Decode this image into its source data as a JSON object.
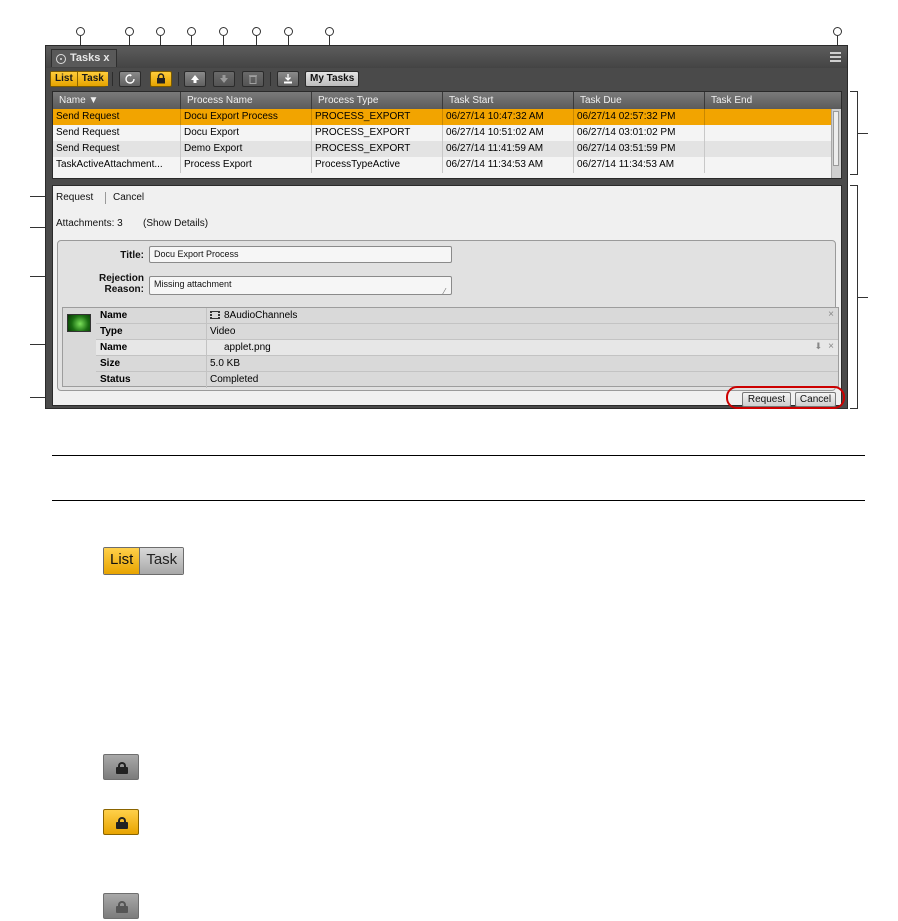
{
  "window": {
    "tab_label": "Tasks x"
  },
  "toolbar": {
    "list_label": "List",
    "task_label": "Task",
    "my_tasks_label": "My Tasks"
  },
  "table": {
    "columns": [
      "Name ▼",
      "Process Name",
      "Process Type",
      "Task Start",
      "Task Due",
      "Task End"
    ],
    "rows": [
      {
        "name": "Send Request",
        "process_name": "Docu Export Process",
        "process_type": "PROCESS_EXPORT",
        "task_start": "06/27/14 10:47:32 AM",
        "task_due": "06/27/14 02:57:32 PM",
        "task_end": ""
      },
      {
        "name": "Send Request",
        "process_name": "Docu Export",
        "process_type": "PROCESS_EXPORT",
        "task_start": "06/27/14 10:51:02 AM",
        "task_due": "06/27/14 03:01:02 PM",
        "task_end": ""
      },
      {
        "name": "Send Request",
        "process_name": "Demo Export",
        "process_type": "PROCESS_EXPORT",
        "task_start": "06/27/14 11:41:59 AM",
        "task_due": "06/27/14 03:51:59 PM",
        "task_end": ""
      },
      {
        "name": "TaskActiveAttachment...",
        "process_name": "Process Export",
        "process_type": "ProcessTypeActive",
        "task_start": "06/27/14 11:34:53 AM",
        "task_due": "06/27/14 11:34:53 AM",
        "task_end": ""
      }
    ],
    "selected_row": 0
  },
  "detail": {
    "request_tab": "Request",
    "cancel_tab": "Cancel",
    "attachments_text": "Attachments: 3",
    "show_details": "(Show Details)",
    "title_label": "Title:",
    "title_value": "Docu Export Process",
    "reason_label_1": "Rejection",
    "reason_label_2": "Reason:",
    "reason_value": "Missing attachment",
    "attachment": {
      "rows": [
        {
          "key": "Name",
          "value": "8AudioChannels"
        },
        {
          "key": "Type",
          "value": "Video"
        },
        {
          "key": "Name",
          "value": "applet.png"
        },
        {
          "key": "Size",
          "value": "5.0 KB"
        },
        {
          "key": "Status",
          "value": "Completed"
        }
      ]
    },
    "request_button": "Request",
    "cancel_button": "Cancel"
  },
  "lower": {
    "list_label": "List",
    "task_label": "Task"
  },
  "colors": {
    "accent": "#f2a400",
    "callout_ring": "#cc0000"
  }
}
